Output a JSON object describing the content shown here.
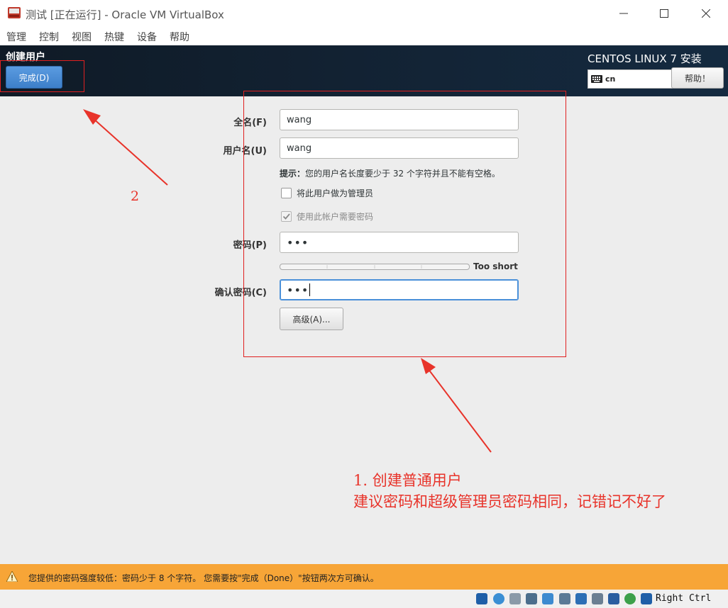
{
  "window": {
    "title": "测试 [正在运行] - Oracle VM VirtualBox"
  },
  "menu": [
    "管理",
    "控制",
    "视图",
    "热键",
    "设备",
    "帮助"
  ],
  "header": {
    "page_title": "创建用户",
    "done_label": "完成(D)",
    "product": "CENTOS LINUX 7 安装",
    "keyboard_layout": "cn",
    "help_label": "帮助！"
  },
  "form": {
    "fullname_label": "全名(F)",
    "fullname_value": "wang",
    "username_label": "用户名(U)",
    "username_value": "wang",
    "hint_prefix": "提示：",
    "hint_text": "您的用户名长度要少于 32 个字符并且不能有空格。",
    "admin_checkbox_label": "将此用户做为管理员",
    "admin_checked": false,
    "require_password_label": "使用此帐户需要密码",
    "require_password_checked": true,
    "password_label": "密码(P)",
    "password_value": "•••",
    "strength_text": "Too short",
    "strength_level": 0,
    "confirm_label": "确认密码(C)",
    "confirm_value": "•••",
    "advanced_label": "高级(A)..."
  },
  "annotations": {
    "note2": "2",
    "note1_line1": "1. 创建普通用户",
    "note1_line2": "建议密码和超级管理员密码相同，记错记不好了"
  },
  "warning": {
    "text": "您提供的密码强度较低：密码少于 8 个字符。 您需要按\"完成（Done）\"按钮两次方可确认。"
  },
  "statusbar": {
    "host_key": "Right Ctrl"
  },
  "colors": {
    "header_bg": "#132436",
    "done_button": "#3d7fc9",
    "warning_bg": "#f7a537",
    "annotation_red": "#e8332a"
  }
}
